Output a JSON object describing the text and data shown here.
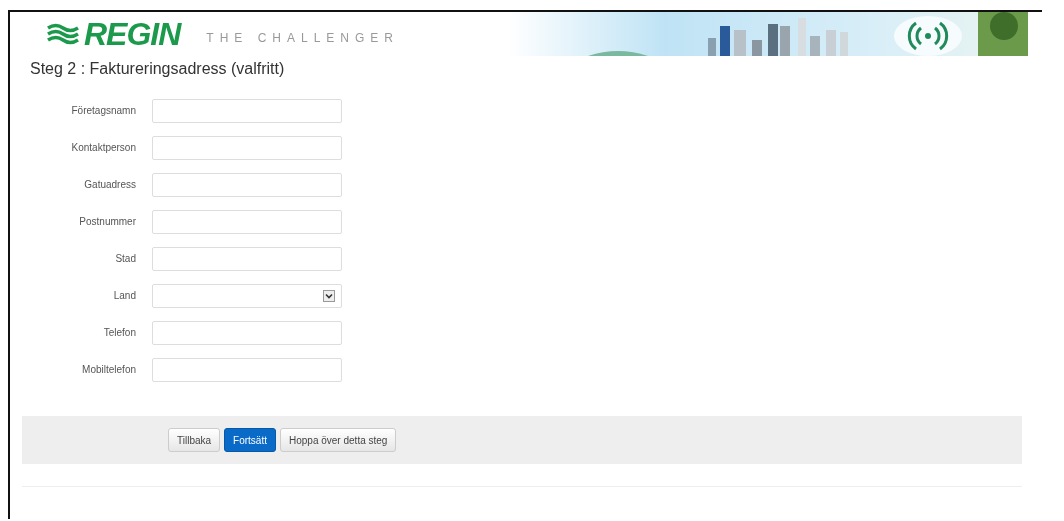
{
  "header": {
    "logo": "REGIN",
    "tagline": "THE CHALLENGER"
  },
  "title": "Steg 2 : Faktureringsadress (valfritt)",
  "fields": [
    {
      "label": "Företagsnamn",
      "kind": "text"
    },
    {
      "label": "Kontaktperson",
      "kind": "text"
    },
    {
      "label": "Gatuadress",
      "kind": "text"
    },
    {
      "label": "Postnummer",
      "kind": "text"
    },
    {
      "label": "Stad",
      "kind": "text"
    },
    {
      "label": "Land",
      "kind": "select"
    },
    {
      "label": "Telefon",
      "kind": "text"
    },
    {
      "label": "Mobiltelefon",
      "kind": "text"
    }
  ],
  "buttons": [
    {
      "label": "Tillbaka",
      "kind": "default"
    },
    {
      "label": "Fortsätt",
      "kind": "primary"
    },
    {
      "label": "Hoppa över detta steg",
      "kind": "default"
    }
  ]
}
